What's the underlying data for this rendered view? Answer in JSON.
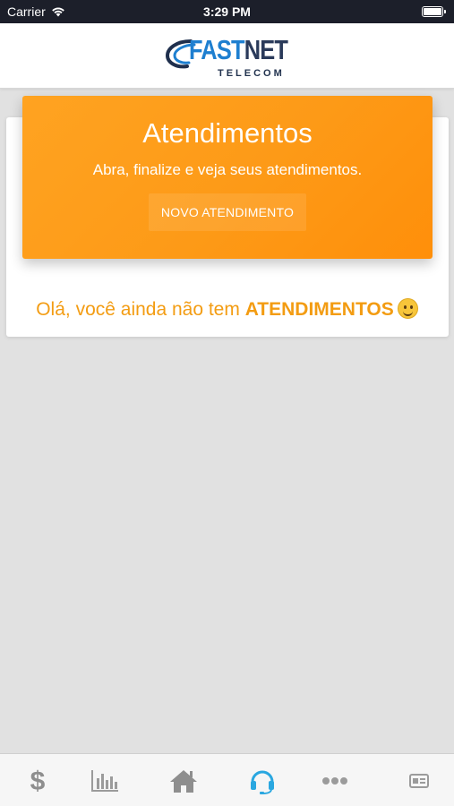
{
  "status_bar": {
    "carrier": "Carrier",
    "time": "3:29 PM"
  },
  "header": {
    "logo": {
      "part1": "FAST",
      "part2": "NET",
      "sub": "TELECOM"
    }
  },
  "hero": {
    "title": "Atendimentos",
    "subtitle": "Abra, finalize e veja seus atendimentos.",
    "button_label": "NOVO ATENDIMENTO"
  },
  "empty_state": {
    "text": "Olá, você ainda não tem ",
    "highlight": "ATENDIMENTOS"
  },
  "tab_bar": {
    "items": [
      {
        "icon": "dollar-icon",
        "active": false
      },
      {
        "icon": "bar-chart-icon",
        "active": false
      },
      {
        "icon": "home-icon",
        "active": false
      },
      {
        "icon": "headset-icon",
        "active": true
      },
      {
        "icon": "more-icon",
        "active": false
      },
      {
        "icon": "id-card-icon",
        "active": false
      }
    ]
  },
  "colors": {
    "accent": "#fd9a17",
    "status_bar": "#1c1f2a",
    "background": "#e1e1e1",
    "tab_active": "#2aa7e0",
    "tab_inactive": "#9b9b9b"
  }
}
